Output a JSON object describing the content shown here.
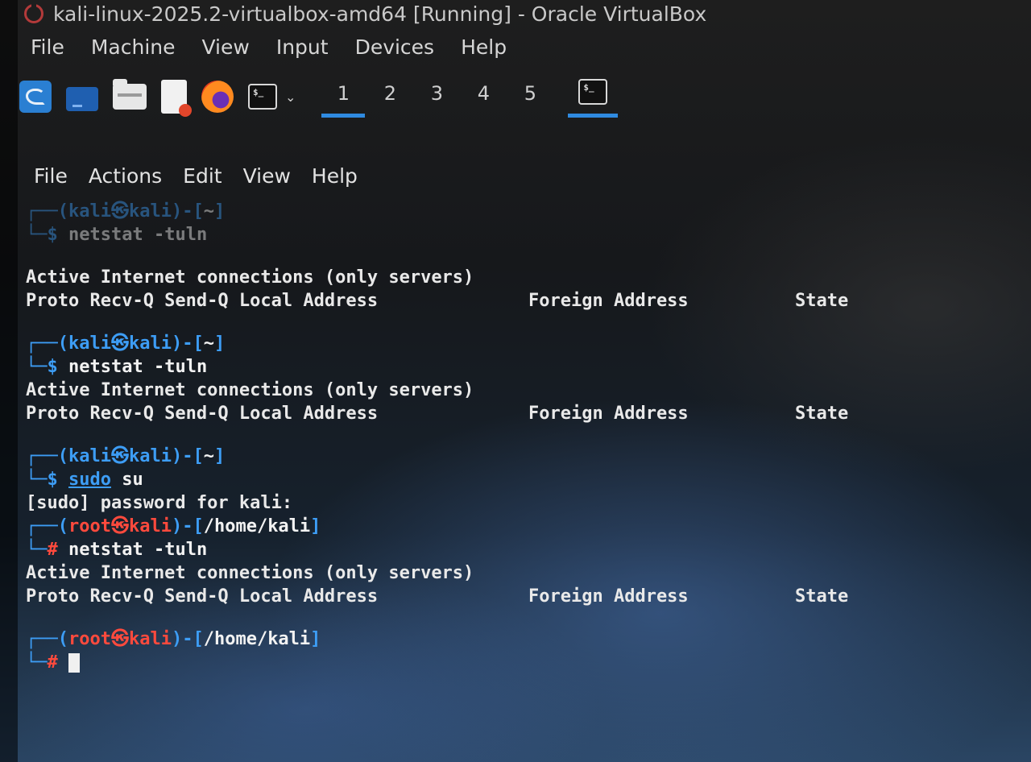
{
  "vbox": {
    "title": "kali-linux-2025.2-virtualbox-amd64 [Running] - Oracle VirtualBox",
    "menu": [
      "File",
      "Machine",
      "View",
      "Input",
      "Devices",
      "Help"
    ]
  },
  "panel": {
    "icons": [
      "kali-menu-icon",
      "desktop-icon",
      "file-manager-icon",
      "text-editor-icon",
      "firefox-icon",
      "terminal-icon"
    ],
    "workspaces": [
      "1",
      "2",
      "3",
      "4",
      "5"
    ],
    "active_workspace": "1"
  },
  "terminal": {
    "menu": [
      "File",
      "Actions",
      "Edit",
      "View",
      "Help"
    ],
    "user_prompt": {
      "open": "┌──(",
      "user": "kali",
      "sep": "㉿",
      "host": "kali",
      "close": ")-[",
      "dir": "~",
      "end": "]",
      "arrow": "└─",
      "sym": "$"
    },
    "root_prompt": {
      "user": "root",
      "host": "kali",
      "dir": "/home/kali",
      "sym": "#"
    },
    "cmd_netstat": "netstat -tuln",
    "cmd_sudo": "sudo",
    "cmd_su": "su",
    "active_conn": "Active Internet connections (only servers)",
    "header_left": "Proto Recv-Q Send-Q Local Address",
    "header_foreign": "Foreign Address",
    "header_state": "State",
    "sudo_password": "[sudo] password for kali:"
  }
}
